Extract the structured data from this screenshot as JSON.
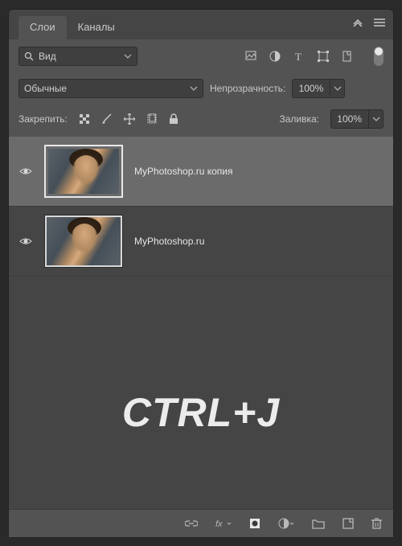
{
  "tabs": {
    "layers": "Слои",
    "channels": "Каналы"
  },
  "filter": {
    "label": "Вид"
  },
  "blend": {
    "mode": "Обычные"
  },
  "opacity": {
    "label": "Непрозрачность:",
    "value": "100%"
  },
  "lock": {
    "label": "Закрепить:"
  },
  "fill": {
    "label": "Заливка:",
    "value": "100%"
  },
  "layers": [
    {
      "name": "MyPhotoshop.ru копия",
      "selected": true
    },
    {
      "name": "MyPhotoshop.ru",
      "selected": false
    }
  ],
  "overlay": "CTRL+J"
}
